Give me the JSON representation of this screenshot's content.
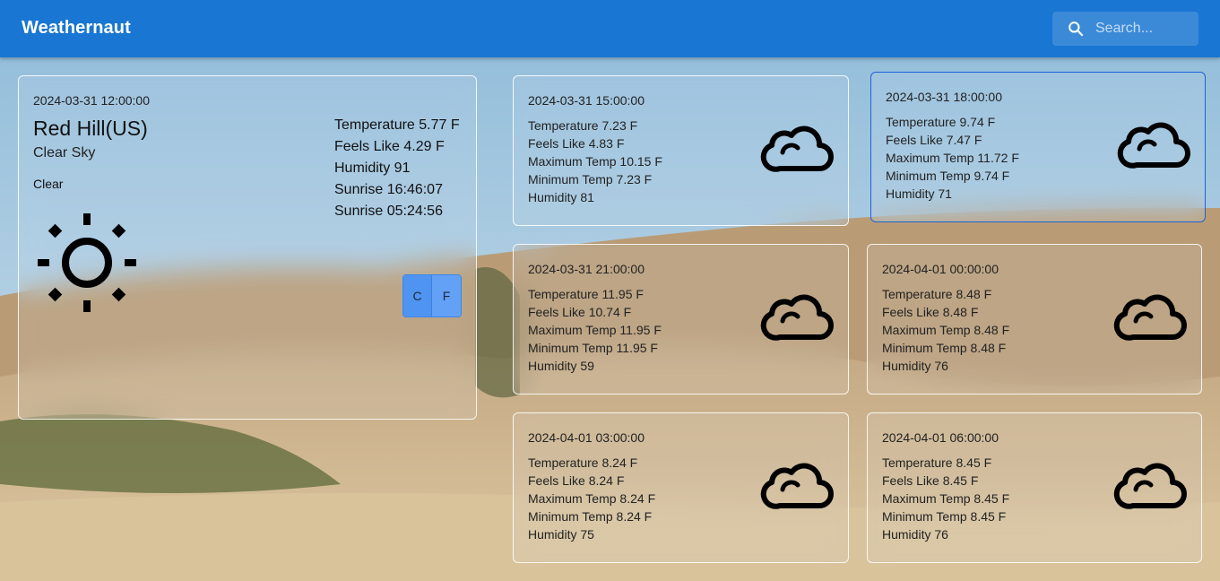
{
  "app": {
    "title": "Weathernaut"
  },
  "search": {
    "placeholder": "Search..."
  },
  "colors": {
    "appbar": "#1976d2",
    "selected_border": "#1e63d6",
    "toggle": "#4f94f0"
  },
  "current": {
    "datetime": "2024-03-31 12:00:00",
    "city": "Red Hill(US)",
    "description": "Clear Sky",
    "main": "Clear",
    "icon": "sun-icon",
    "stats": [
      "Temperature 5.77 F",
      "Feels Like 4.29 F",
      "Humidity 91",
      "Sunrise 16:46:07",
      "Sunrise 05:24:56"
    ],
    "units": {
      "c": "C",
      "f": "F"
    }
  },
  "forecast": [
    {
      "datetime": "2024-03-31 15:00:00",
      "lines": [
        "Temperature 7.23 F",
        "Feels Like 4.83 F",
        "Maximum Temp 10.15 F",
        "Minimum Temp 7.23 F",
        "Humidity 81"
      ],
      "icon": "cloud-icon"
    },
    {
      "datetime": "2024-03-31 18:00:00",
      "lines": [
        "Temperature 9.74 F",
        "Feels Like 7.47 F",
        "Maximum Temp 11.72 F",
        "Minimum Temp 9.74 F",
        "Humidity 71"
      ],
      "icon": "cloud-icon"
    },
    {
      "datetime": "2024-03-31 21:00:00",
      "lines": [
        "Temperature 11.95 F",
        "Feels Like 10.74 F",
        "Maximum Temp 11.95 F",
        "Minimum Temp 11.95 F",
        "Humidity 59"
      ],
      "icon": "cloud-icon"
    },
    {
      "datetime": "2024-04-01 00:00:00",
      "lines": [
        "Temperature 8.48 F",
        "Feels Like 8.48 F",
        "Maximum Temp 8.48 F",
        "Minimum Temp 8.48 F",
        "Humidity 76"
      ],
      "icon": "cloud-icon"
    },
    {
      "datetime": "2024-04-01 03:00:00",
      "lines": [
        "Temperature 8.24 F",
        "Feels Like 8.24 F",
        "Maximum Temp 8.24 F",
        "Minimum Temp 8.24 F",
        "Humidity 75"
      ],
      "icon": "cloud-icon"
    },
    {
      "datetime": "2024-04-01 06:00:00",
      "lines": [
        "Temperature 8.45 F",
        "Feels Like 8.45 F",
        "Maximum Temp 8.45 F",
        "Minimum Temp 8.45 F",
        "Humidity 76"
      ],
      "icon": "cloud-icon"
    }
  ]
}
